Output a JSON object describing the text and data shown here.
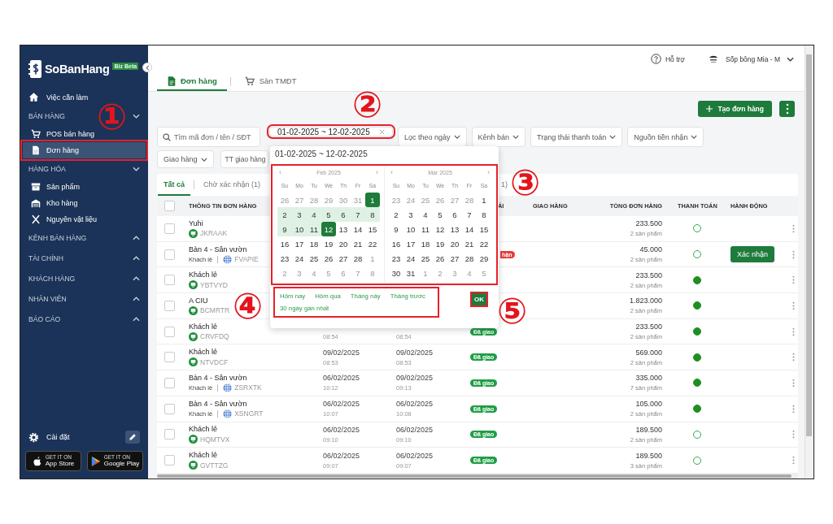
{
  "sidebar": {
    "logo": {
      "name": "SoBanHang",
      "badge": "Biz Beta"
    },
    "nav": [
      {
        "kind": "item",
        "label": "Việc cần làm",
        "selected": false
      },
      {
        "kind": "section",
        "label": "BÁN HÀNG",
        "expanded": true,
        "children": [
          {
            "label": "POS bán hàng",
            "selected": false,
            "annotated": false
          },
          {
            "label": "Đơn hàng",
            "selected": true,
            "annotated": true
          }
        ]
      },
      {
        "kind": "section",
        "label": "HÀNG HÓA",
        "expanded": true,
        "children": [
          {
            "label": "Sản phẩm",
            "selected": false,
            "annotated": false
          },
          {
            "label": "Kho hàng",
            "selected": false,
            "annotated": false
          },
          {
            "label": "Nguyên vật liệu",
            "selected": false,
            "annotated": false
          }
        ]
      },
      {
        "kind": "section",
        "label": "KÊNH BÁN HÀNG",
        "expanded": false
      },
      {
        "kind": "section",
        "label": "TÀI CHÍNH",
        "expanded": false
      },
      {
        "kind": "section",
        "label": "KHÁCH HÀNG",
        "expanded": false
      },
      {
        "kind": "section",
        "label": "NHÂN VIÊN",
        "expanded": false
      },
      {
        "kind": "section",
        "label": "BÁO CÁO",
        "expanded": false
      }
    ],
    "settings": "Cài đặt",
    "stores": [
      {
        "small": "GET IT ON",
        "label": "App Store"
      },
      {
        "small": "GET IT ON",
        "label": "Google Play"
      }
    ]
  },
  "topbar": {
    "help": "Hỗ trợ",
    "user": "Sốp bông Mia - M"
  },
  "tabs": [
    {
      "label": "Đơn hàng",
      "selected": true
    },
    {
      "label": "Sàn TMĐT",
      "selected": false
    }
  ],
  "create_button": "Tạo đơn hàng",
  "filters": {
    "search": {
      "placeholder": "Tìm mã đơn / tên / SĐT"
    },
    "date_range": {
      "value": "01-02-2025 ~ 12-02-2025",
      "annotated": true
    },
    "dropdowns": [
      "Lọc theo ngày",
      "Kênh bán",
      "Trạng thái thanh toán",
      "Nguồn tiền nhận",
      "Giao hàng"
    ],
    "cut_dropdown": "TT giao hàng"
  },
  "date_picker": {
    "value": "01-02-2025 ~ 12-02-2025",
    "annotated": true,
    "months": [
      {
        "title": "Feb 2025",
        "prev": "‹",
        "next": "›",
        "weekdays": [
          "Su",
          "Mo",
          "Tu",
          "We",
          "Th",
          "Fr",
          "Sa"
        ],
        "weeks": [
          [
            {
              "day": "26",
              "kind": "out"
            },
            {
              "day": "27",
              "kind": "out"
            },
            {
              "day": "28",
              "kind": "out"
            },
            {
              "day": "29",
              "kind": "out"
            },
            {
              "day": "30",
              "kind": "out"
            },
            {
              "day": "31",
              "kind": "out"
            },
            {
              "day": "1",
              "kind": "end"
            }
          ],
          [
            {
              "day": "2",
              "kind": "range"
            },
            {
              "day": "3",
              "kind": "range"
            },
            {
              "day": "4",
              "kind": "range"
            },
            {
              "day": "5",
              "kind": "range"
            },
            {
              "day": "6",
              "kind": "range"
            },
            {
              "day": "7",
              "kind": "range"
            },
            {
              "day": "8",
              "kind": "range"
            }
          ],
          [
            {
              "day": "9",
              "kind": "range"
            },
            {
              "day": "10",
              "kind": "range"
            },
            {
              "day": "11",
              "kind": "range"
            },
            {
              "day": "12",
              "kind": "end"
            },
            {
              "day": "13",
              "kind": "in"
            },
            {
              "day": "14",
              "kind": "in"
            },
            {
              "day": "15",
              "kind": "in"
            }
          ],
          [
            {
              "day": "16",
              "kind": "in"
            },
            {
              "day": "17",
              "kind": "in"
            },
            {
              "day": "18",
              "kind": "in"
            },
            {
              "day": "19",
              "kind": "in"
            },
            {
              "day": "20",
              "kind": "in"
            },
            {
              "day": "21",
              "kind": "in"
            },
            {
              "day": "22",
              "kind": "in"
            }
          ],
          [
            {
              "day": "23",
              "kind": "in"
            },
            {
              "day": "24",
              "kind": "in"
            },
            {
              "day": "25",
              "kind": "in"
            },
            {
              "day": "26",
              "kind": "in"
            },
            {
              "day": "27",
              "kind": "in"
            },
            {
              "day": "28",
              "kind": "in"
            },
            {
              "day": "1",
              "kind": "out"
            }
          ],
          [
            {
              "day": "2",
              "kind": "out"
            },
            {
              "day": "3",
              "kind": "out"
            },
            {
              "day": "4",
              "kind": "out"
            },
            {
              "day": "5",
              "kind": "out"
            },
            {
              "day": "6",
              "kind": "out"
            },
            {
              "day": "7",
              "kind": "out"
            },
            {
              "day": "8",
              "kind": "out"
            }
          ]
        ]
      },
      {
        "title": "Mar 2025",
        "prev": "‹",
        "next": "›",
        "weekdays": [
          "Su",
          "Mo",
          "Tu",
          "We",
          "Th",
          "Fr",
          "Sa"
        ],
        "weeks": [
          [
            {
              "day": "23",
              "kind": "out"
            },
            {
              "day": "24",
              "kind": "out"
            },
            {
              "day": "25",
              "kind": "out"
            },
            {
              "day": "26",
              "kind": "out"
            },
            {
              "day": "27",
              "kind": "out"
            },
            {
              "day": "28",
              "kind": "out"
            },
            {
              "day": "1",
              "kind": "in"
            }
          ],
          [
            {
              "day": "2",
              "kind": "in"
            },
            {
              "day": "3",
              "kind": "in"
            },
            {
              "day": "4",
              "kind": "in"
            },
            {
              "day": "5",
              "kind": "in"
            },
            {
              "day": "6",
              "kind": "in"
            },
            {
              "day": "7",
              "kind": "in"
            },
            {
              "day": "8",
              "kind": "in"
            }
          ],
          [
            {
              "day": "9",
              "kind": "in"
            },
            {
              "day": "10",
              "kind": "in"
            },
            {
              "day": "11",
              "kind": "in"
            },
            {
              "day": "12",
              "kind": "in"
            },
            {
              "day": "13",
              "kind": "in"
            },
            {
              "day": "14",
              "kind": "in"
            },
            {
              "day": "15",
              "kind": "in"
            }
          ],
          [
            {
              "day": "16",
              "kind": "in"
            },
            {
              "day": "17",
              "kind": "in"
            },
            {
              "day": "18",
              "kind": "in"
            },
            {
              "day": "19",
              "kind": "in"
            },
            {
              "day": "20",
              "kind": "in"
            },
            {
              "day": "21",
              "kind": "in"
            },
            {
              "day": "22",
              "kind": "in"
            }
          ],
          [
            {
              "day": "23",
              "kind": "in"
            },
            {
              "day": "24",
              "kind": "in"
            },
            {
              "day": "25",
              "kind": "in"
            },
            {
              "day": "26",
              "kind": "in"
            },
            {
              "day": "27",
              "kind": "in"
            },
            {
              "day": "28",
              "kind": "in"
            },
            {
              "day": "29",
              "kind": "in"
            }
          ],
          [
            {
              "day": "30",
              "kind": "in"
            },
            {
              "day": "31",
              "kind": "in"
            },
            {
              "day": "1",
              "kind": "out"
            },
            {
              "day": "2",
              "kind": "out"
            },
            {
              "day": "3",
              "kind": "out"
            },
            {
              "day": "4",
              "kind": "out"
            },
            {
              "day": "5",
              "kind": "out"
            }
          ]
        ]
      }
    ],
    "shortcuts": [
      "Hôm nay",
      "Hôm qua",
      "Tháng này",
      "Tháng trước",
      "30 ngày gần nhất"
    ],
    "shortcuts_annotated": true,
    "ok": {
      "label": "OK",
      "annotated": true
    }
  },
  "order_tabs": [
    {
      "label": "Tất cả",
      "selected": true
    },
    {
      "label": "Chờ xác nhận (1)",
      "selected": false
    },
    {
      "label": "1)",
      "selected": false
    }
  ],
  "table": {
    "header": {
      "checked": false,
      "info": "THÔNG TIN ĐƠN HÀNG",
      "column_4": "ÁI",
      "delivery": "GIAO HÀNG",
      "total": "TỔNG ĐƠN HÀNG",
      "payment": "THANH TOÁN",
      "action": "HÀNH ĐỘNG"
    },
    "rows": [
      {
        "checked": false,
        "customer": "Yuhi",
        "kind": "pos",
        "code": "JKRAAK",
        "total": "233.500",
        "items": "2 sản phẩm",
        "paid": false
      },
      {
        "checked": false,
        "customer": "Bàn 4 - Sân vườn",
        "kind": "web",
        "sub_label": "Khách lẻ",
        "code": "FVAPIE",
        "status": {
          "text": "hận",
          "kind": "pending"
        },
        "total": "45.000",
        "items": "2 sản phẩm",
        "paid": false,
        "action": "Xác nhận"
      },
      {
        "checked": false,
        "customer": "Khách lẻ",
        "kind": "pos",
        "code": "YBTVYD",
        "total": "233.500",
        "items": "2 sản phẩm",
        "paid": true
      },
      {
        "checked": false,
        "customer": "A CIU",
        "kind": "pos",
        "code": "BCMRTR",
        "total": "1.823.000",
        "items": "2 sản phẩm",
        "paid": true
      },
      {
        "checked": false,
        "customer": "Khách lẻ",
        "kind": "pos",
        "code": "CRVFDQ",
        "created_time": "08:54",
        "updated_time": "08:54",
        "status": {
          "text": "Đã giao",
          "kind": "delivered"
        },
        "total": "233.500",
        "items": "2 sản phẩm",
        "paid": true
      },
      {
        "checked": false,
        "customer": "Khách lẻ",
        "kind": "pos",
        "code": "NTVDCF",
        "created_date": "09/02/2025",
        "created_time": "08:53",
        "updated_date": "09/02/2025",
        "updated_time": "08:53",
        "status": {
          "text": "Đã giao",
          "kind": "delivered"
        },
        "total": "569.000",
        "items": "2 sản phẩm",
        "paid": true
      },
      {
        "checked": false,
        "customer": "Bàn 4 - Sân vườn",
        "kind": "web",
        "sub_label": "Khách lẻ",
        "code": "ZSRXTK",
        "created_date": "06/02/2025",
        "created_time": "10:12",
        "updated_date": "09/02/2025",
        "updated_time": "09:13",
        "status": {
          "text": "Đã giao",
          "kind": "delivered"
        },
        "total": "335.000",
        "items": "7 sản phẩm",
        "paid": true
      },
      {
        "checked": false,
        "customer": "Bàn 4 - Sân vườn",
        "kind": "web",
        "sub_label": "Khách lẻ",
        "code": "XSNGRT",
        "created_date": "06/02/2025",
        "created_time": "10:07",
        "updated_date": "06/02/2025",
        "updated_time": "10:08",
        "status": {
          "text": "Đã giao",
          "kind": "delivered"
        },
        "total": "105.000",
        "items": "2 sản phẩm",
        "paid": true
      },
      {
        "checked": false,
        "customer": "Khách lẻ",
        "kind": "pos",
        "code": "HQMTVX",
        "created_date": "06/02/2025",
        "created_time": "09:10",
        "updated_date": "06/02/2025",
        "updated_time": "09:10",
        "status": {
          "text": "Đã giao",
          "kind": "delivered"
        },
        "total": "189.500",
        "items": "2 sản phẩm",
        "paid": false
      },
      {
        "checked": false,
        "customer": "Khách lẻ",
        "kind": "pos",
        "code": "GVTTZG",
        "created_date": "06/02/2025",
        "created_time": "09:07",
        "updated_date": "06/02/2025",
        "updated_time": "09:07",
        "status": {
          "text": "Đã giao",
          "kind": "delivered"
        },
        "total": "189.500",
        "items": "3 sản phẩm",
        "paid": false
      }
    ]
  },
  "annotations": [
    {
      "text": "①"
    },
    {
      "text": "②"
    },
    {
      "text": "③"
    },
    {
      "text": "④"
    },
    {
      "text": "⑤"
    }
  ]
}
